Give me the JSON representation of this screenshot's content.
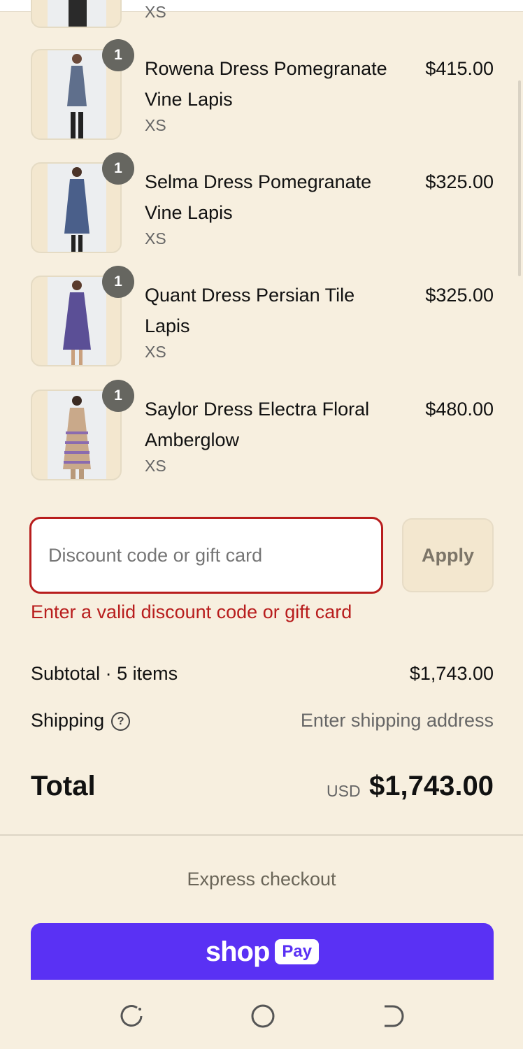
{
  "items": [
    {
      "name": "Rowena Dress Pomegranate Vine Lapis",
      "size": "XS",
      "price": "$415.00",
      "qty": "1",
      "dress_color": "#5f6f8c"
    },
    {
      "name": "Selma Dress Pomegranate Vine Lapis",
      "size": "XS",
      "price": "$325.00",
      "qty": "1",
      "dress_color": "#4a5f8a"
    },
    {
      "name": "Quant Dress Persian Tile Lapis",
      "size": "XS",
      "price": "$325.00",
      "qty": "1",
      "dress_color": "#5b4f96"
    },
    {
      "name": "Saylor Dress Electra Floral Amberglow",
      "size": "XS",
      "price": "$480.00",
      "qty": "1",
      "dress_color": "#c9a98a"
    }
  ],
  "previous_item_size": "XS",
  "discount": {
    "placeholder": "Discount code or gift card",
    "apply_label": "Apply",
    "error": "Enter a valid discount code or gift card"
  },
  "summary": {
    "subtotal_label": "Subtotal · 5 items",
    "subtotal_value": "$1,743.00",
    "shipping_label": "Shipping",
    "shipping_value": "Enter shipping address",
    "total_label": "Total",
    "currency": "USD",
    "total_value": "$1,743.00"
  },
  "express": {
    "label": "Express checkout",
    "shop_word": "shop",
    "pay_word": "Pay"
  },
  "colors": {
    "background": "#f7efdf",
    "error": "#b81d1d",
    "shop_pay": "#5a31f4"
  }
}
